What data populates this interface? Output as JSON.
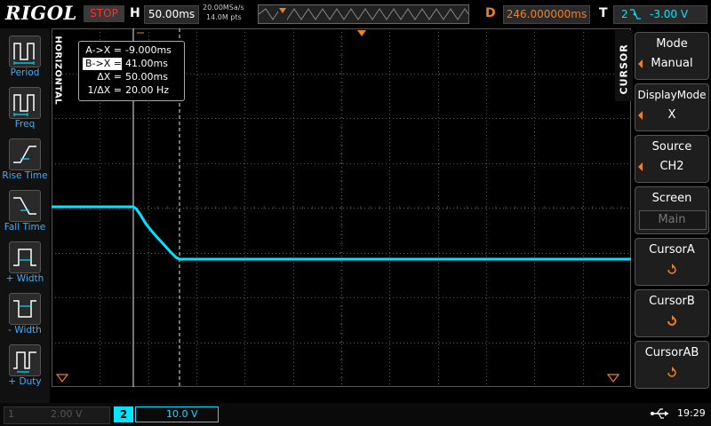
{
  "header": {
    "logo": "RIGOL",
    "run_state": "STOP",
    "h_label": "H",
    "timebase": "50.00ms",
    "sample_rate": "20.00MSa/s",
    "memory_depth": "14.0M pts",
    "d_label": "D",
    "delay": "246.000000ms",
    "t_label": "T",
    "trigger_level": "-3.00 V"
  },
  "left_menu": [
    {
      "label": "Period"
    },
    {
      "label": "Freq"
    },
    {
      "label": "Rise Time"
    },
    {
      "label": "Fall Time"
    },
    {
      "label": "+ Width"
    },
    {
      "label": "- Width"
    },
    {
      "label": "+ Duty"
    }
  ],
  "horizontal_tab": "HORIZONTAL",
  "cursor_tab": "CURSOR",
  "measurements": [
    {
      "key": "A->X =",
      "value": "-9.000ms",
      "selected": false
    },
    {
      "key": "B->X =",
      "value": "41.00ms",
      "selected": true
    },
    {
      "key": "ΔX =",
      "value": "50.00ms",
      "selected": false
    },
    {
      "key": "1/ΔX =",
      "value": "20.00 Hz",
      "selected": false
    }
  ],
  "right_menu": {
    "mode": {
      "title": "Mode",
      "value": "Manual"
    },
    "display_mode": {
      "title": "DisplayMode",
      "value": "X"
    },
    "source": {
      "title": "Source",
      "value": "CH2"
    },
    "screen": {
      "title": "Screen",
      "value": "Main"
    },
    "cursor_a": {
      "title": "CursorA"
    },
    "cursor_b": {
      "title": "CursorB"
    },
    "cursor_ab": {
      "title": "CursorAB"
    }
  },
  "bottom": {
    "ch1_num": "1",
    "ch1_scale": "2.00 V",
    "ch2_num": "2",
    "ch2_scale": "10.0 V",
    "time": "19:29"
  },
  "colors": {
    "trace": "#00e5ff",
    "accent": "#f08020",
    "menu_label": "#3ab0ff",
    "stop": "#ff3030"
  }
}
